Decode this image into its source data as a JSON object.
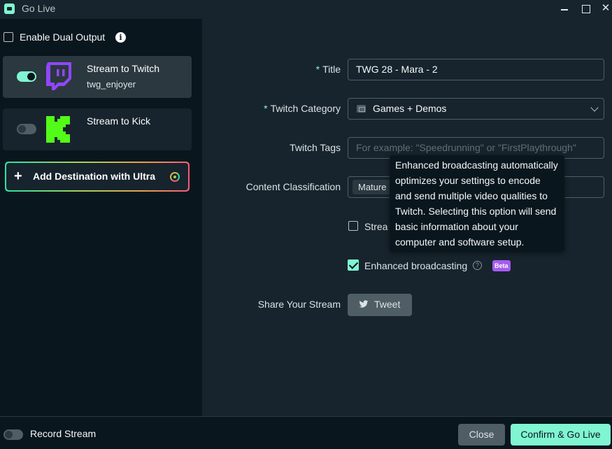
{
  "window": {
    "title": "Go Live",
    "close_glyph": "✕"
  },
  "left": {
    "dual_output_label": "Enable Dual Output",
    "info_glyph": "i",
    "destinations": [
      {
        "name": "Stream to Twitch",
        "user": "twg_enjoyer",
        "enabled": true,
        "icon": "twitch-logo"
      },
      {
        "name": "Stream to Kick",
        "user": "",
        "enabled": false,
        "icon": "kick-logo"
      }
    ],
    "add_destination_label": "Add Destination with Ultra",
    "plus_glyph": "+"
  },
  "form": {
    "title_label": "Title",
    "title_value": "TWG 28 - Mara - 2",
    "category_label": "Twitch Category",
    "category_value": "Games + Demos",
    "tags_label": "Twitch Tags",
    "tags_placeholder": "For example: \"Speedrunning\" or \"FirstPlaythrough\"",
    "classification_label": "Content Classification",
    "classification_chip": "Mature",
    "stream_checkbox_label": "Strea",
    "enhanced_label": "Enhanced broadcasting",
    "help_glyph": "?",
    "beta_label": "Beta",
    "share_label": "Share Your Stream",
    "tweet_label": "Tweet",
    "required_mark": "*"
  },
  "tooltip": {
    "text": "Enhanced broadcasting automatically optimizes your settings to encode and send multiple video qualities to Twitch. Selecting this option will send basic information about your computer and software setup."
  },
  "footer": {
    "record_label": "Record Stream",
    "close_label": "Close",
    "confirm_label": "Confirm & Go Live"
  },
  "colors": {
    "accent": "#80f5d2",
    "twitch": "#9146ff",
    "kick": "#53fc18",
    "beta": "#a45cf0",
    "panel": "#17242d",
    "background": "#09161d"
  }
}
